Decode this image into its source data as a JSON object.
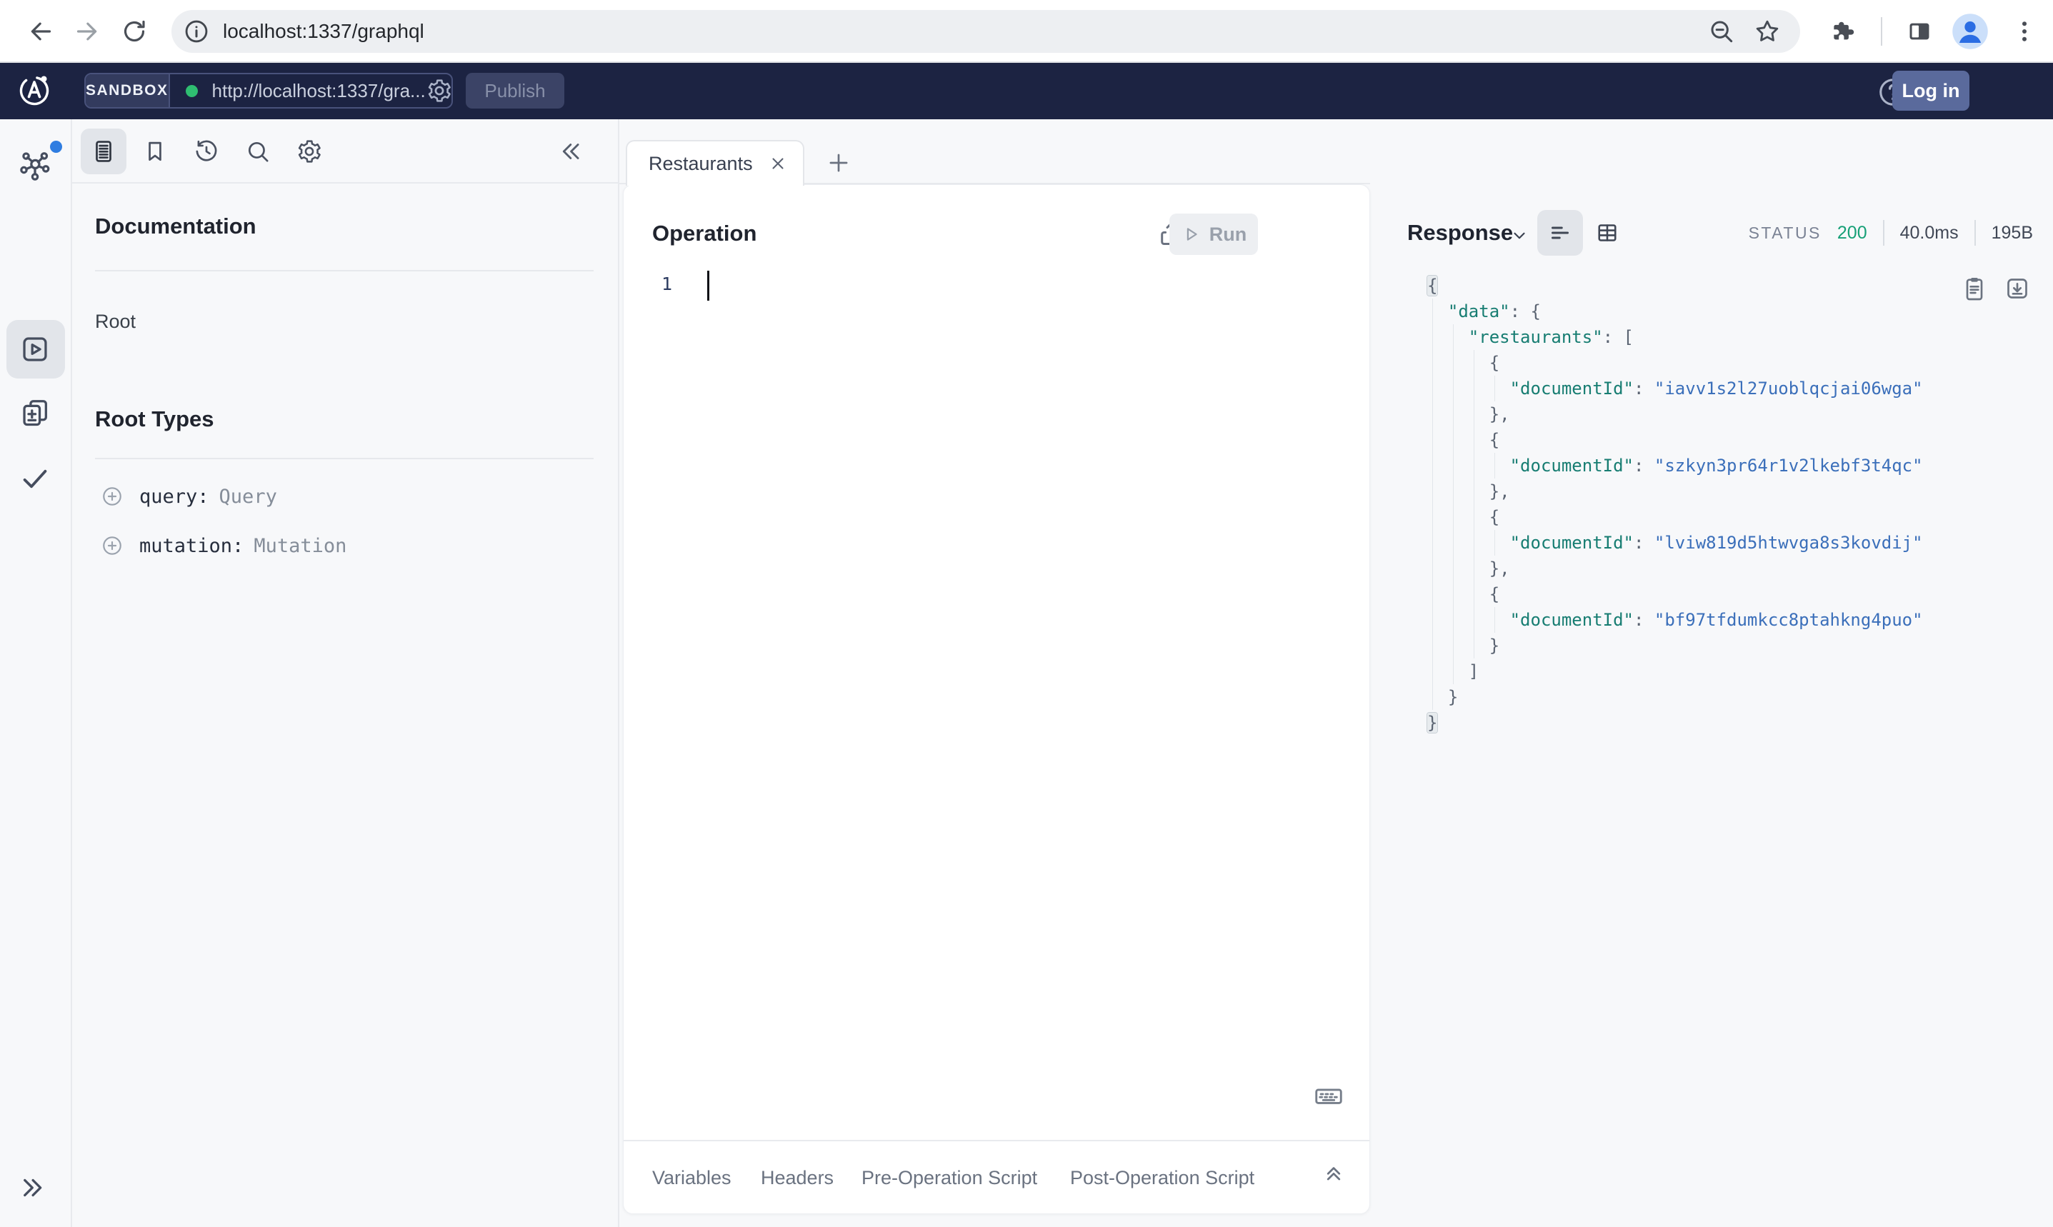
{
  "browser": {
    "url": "localhost:1337/graphql"
  },
  "apollo_bar": {
    "env_label": "SANDBOX",
    "endpoint": "http://localhost:1337/gra...",
    "publish_label": "Publish",
    "login_label": "Log in"
  },
  "doc_panel": {
    "title": "Documentation",
    "root_label": "Root",
    "root_types_title": "Root Types",
    "fields": [
      {
        "label": "query:",
        "type": "Query"
      },
      {
        "label": "mutation:",
        "type": "Mutation"
      }
    ]
  },
  "tabs": {
    "active_label": "Restaurants"
  },
  "operation": {
    "title": "Operation",
    "run_label": "Run",
    "line_number": "1"
  },
  "dock_tabs": [
    {
      "label": "Variables"
    },
    {
      "label": "Headers"
    },
    {
      "label": "Pre-Operation Script"
    },
    {
      "label": "Post-Operation Script"
    }
  ],
  "response": {
    "title": "Response",
    "status_label": "STATUS",
    "status_code": "200",
    "duration": "40.0ms",
    "size": "195B",
    "body": {
      "data": {
        "restaurants": [
          {
            "documentId": "iavv1s2l27uoblqcjai06wga"
          },
          {
            "documentId": "szkyn3pr64r1v2lkebf3t4qc"
          },
          {
            "documentId": "lviw819d5htwvga8s3kovdij"
          },
          {
            "documentId": "bf97tfdumkcc8ptahkng4puo"
          }
        ]
      }
    }
  },
  "colors": {
    "navy": "#1c2342",
    "status_green": "#17a077",
    "json_key": "#177d72",
    "json_string": "#3b6fba",
    "endpoint_dot_green": "#2fbe71",
    "notification_blue": "#4aa0f5"
  }
}
